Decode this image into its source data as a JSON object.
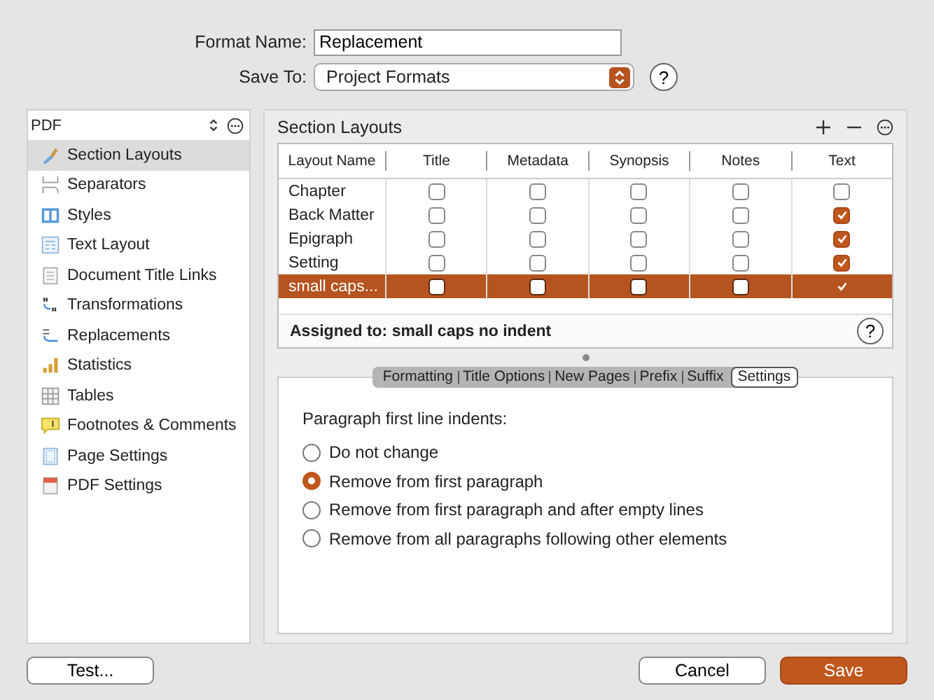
{
  "format_name": {
    "label": "Format Name:",
    "value": "Replacement"
  },
  "save_to": {
    "label": "Save To:",
    "value": "Project Formats",
    "help": "?"
  },
  "sidebar": {
    "format": "PDF",
    "items": [
      {
        "label": "Section Layouts",
        "selected": true
      },
      {
        "label": "Separators",
        "selected": false
      },
      {
        "label": "Styles",
        "selected": false
      },
      {
        "label": "Text Layout",
        "selected": false
      },
      {
        "label": "Document Title Links",
        "selected": false
      },
      {
        "label": "Transformations",
        "selected": false
      },
      {
        "label": "Replacements",
        "selected": false
      },
      {
        "label": "Statistics",
        "selected": false
      },
      {
        "label": "Tables",
        "selected": false
      },
      {
        "label": "Footnotes & Comments",
        "selected": false
      },
      {
        "label": "Page Settings",
        "selected": false
      },
      {
        "label": "PDF Settings",
        "selected": false
      }
    ]
  },
  "section_layouts": {
    "title": "Section Layouts",
    "columns": [
      "Layout Name",
      "Title",
      "Metadata",
      "Synopsis",
      "Notes",
      "Text"
    ],
    "rows": [
      {
        "name": "Chapter",
        "checks": [
          false,
          false,
          false,
          false,
          false
        ],
        "selected": false
      },
      {
        "name": "Back Matter",
        "checks": [
          false,
          false,
          false,
          false,
          true
        ],
        "selected": false
      },
      {
        "name": "Epigraph",
        "checks": [
          false,
          false,
          false,
          false,
          true
        ],
        "selected": false
      },
      {
        "name": "Setting",
        "checks": [
          false,
          false,
          false,
          false,
          true
        ],
        "selected": false
      },
      {
        "name": "small caps...",
        "checks": [
          false,
          false,
          false,
          false,
          true
        ],
        "selected": true
      }
    ],
    "assigned_label": "Assigned to:",
    "assigned_value": "small caps no indent",
    "help": "?"
  },
  "tabs": [
    {
      "label": "Formatting",
      "selected": false
    },
    {
      "label": "Title Options",
      "selected": false
    },
    {
      "label": "New Pages",
      "selected": false
    },
    {
      "label": "Prefix",
      "selected": false
    },
    {
      "label": "Suffix",
      "selected": false
    },
    {
      "label": "Settings",
      "selected": true
    }
  ],
  "settings": {
    "heading": "Paragraph first line indents:",
    "options": [
      {
        "label": "Do not change",
        "selected": false
      },
      {
        "label": "Remove from first paragraph",
        "selected": true
      },
      {
        "label": "Remove from first paragraph and after empty lines",
        "selected": false
      },
      {
        "label": "Remove from all paragraphs following other elements",
        "selected": false
      }
    ]
  },
  "buttons": {
    "test": "Test...",
    "cancel": "Cancel",
    "save": "Save"
  }
}
